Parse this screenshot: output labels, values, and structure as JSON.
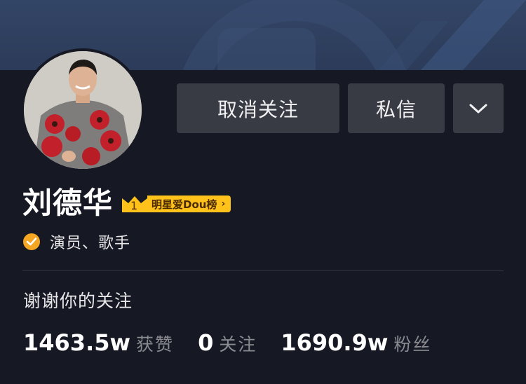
{
  "profile": {
    "name": "刘德华",
    "rank_number": "1",
    "rank_label": "明星爱Dou榜",
    "rank_arrow": "›",
    "verification": "演员、歌手",
    "bio": "谢谢你的关注"
  },
  "actions": {
    "unfollow_label": "取消关注",
    "message_label": "私信",
    "more_icon": "chevron-down-icon"
  },
  "stats": [
    {
      "value": "1463.5w",
      "label": "获赞"
    },
    {
      "value": "0",
      "label": "关注"
    },
    {
      "value": "1690.9w",
      "label": "粉丝"
    }
  ],
  "colors": {
    "background": "#161823",
    "button": "#393b44",
    "badge": "#ffc21a",
    "verify": "#f5a623"
  }
}
